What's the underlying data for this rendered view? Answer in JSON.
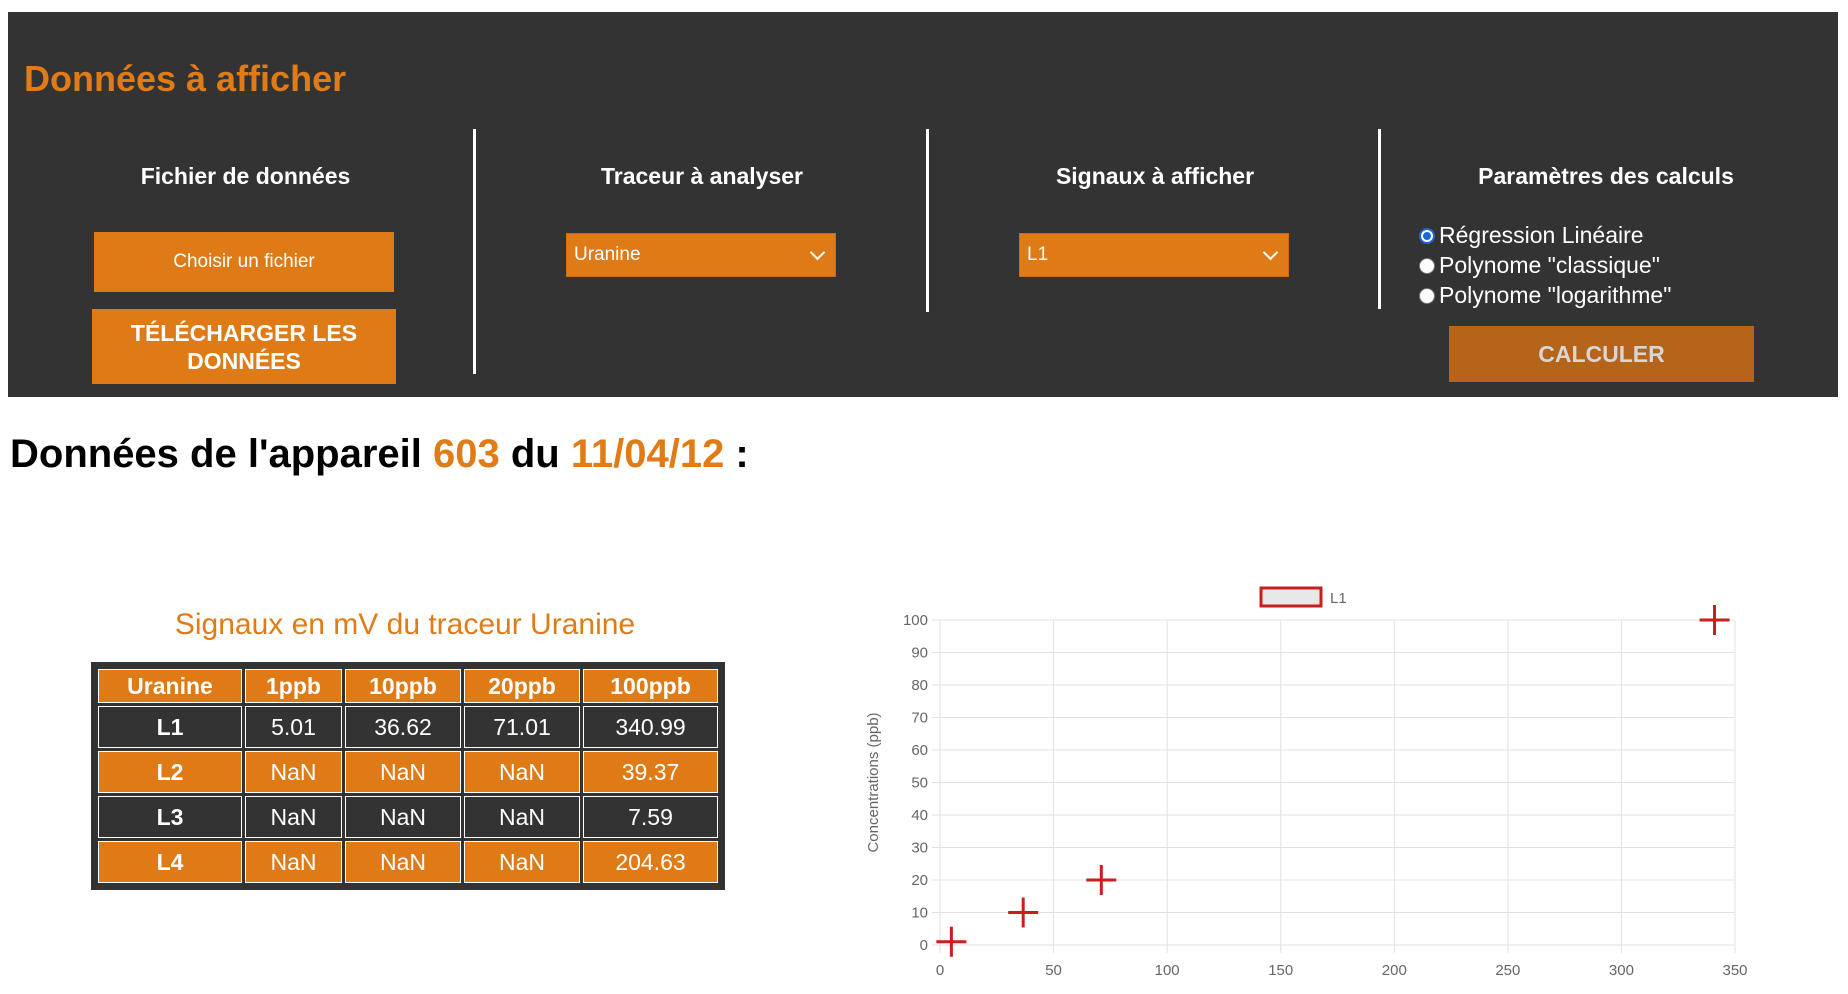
{
  "panel": {
    "title": "Données à afficher",
    "file_section": {
      "heading": "Fichier de données",
      "choose_button": "Choisir un fichier",
      "download_button": "TÉLÉCHARGER LES DONNÉES"
    },
    "tracer_section": {
      "heading": "Traceur à analyser",
      "selected": "Uranine"
    },
    "signal_section": {
      "heading": "Signaux à afficher",
      "selected": "L1"
    },
    "params_section": {
      "heading": "Paramètres des calculs",
      "options": [
        {
          "label": "Régression Linéaire",
          "checked": true
        },
        {
          "label": "Polynome \"classique\"",
          "checked": false
        },
        {
          "label": "Polynome \"logarithme\"",
          "checked": false
        }
      ],
      "calculate_button": "CALCULER"
    }
  },
  "heading": {
    "prefix": "Données de l'appareil ",
    "device": "603",
    "middle": " du ",
    "date": "11/04/12",
    "suffix": " :"
  },
  "table": {
    "title": "Signaux en mV du traceur Uranine",
    "columns": [
      "Uranine",
      "1ppb",
      "10ppb",
      "20ppb",
      "100ppb"
    ],
    "rows": [
      [
        "L1",
        "5.01",
        "36.62",
        "71.01",
        "340.99"
      ],
      [
        "L2",
        "NaN",
        "NaN",
        "NaN",
        "39.37"
      ],
      [
        "L3",
        "NaN",
        "NaN",
        "NaN",
        "7.59"
      ],
      [
        "L4",
        "NaN",
        "NaN",
        "NaN",
        "204.63"
      ]
    ]
  },
  "colors": {
    "accent": "#e07b16",
    "panel_bg": "#333333",
    "point": "#c81e1e"
  },
  "chart_data": {
    "type": "scatter",
    "title": "",
    "xlabel": "",
    "ylabel": "Concentrations (ppb)",
    "legend_placement": "top-center",
    "grid": true,
    "xlim": [
      0,
      350
    ],
    "ylim": [
      0,
      100
    ],
    "x_ticks": [
      "0",
      "50",
      "100",
      "150",
      "200",
      "250",
      "300",
      "350"
    ],
    "y_ticks": [
      "0",
      "10",
      "20",
      "30",
      "40",
      "50",
      "60",
      "70",
      "80",
      "90",
      "100"
    ],
    "series": [
      {
        "name": "L1",
        "points": [
          {
            "x": 5.01,
            "y": 1
          },
          {
            "x": 36.62,
            "y": 10
          },
          {
            "x": 71.01,
            "y": 20
          },
          {
            "x": 340.99,
            "y": 100
          }
        ]
      }
    ]
  }
}
